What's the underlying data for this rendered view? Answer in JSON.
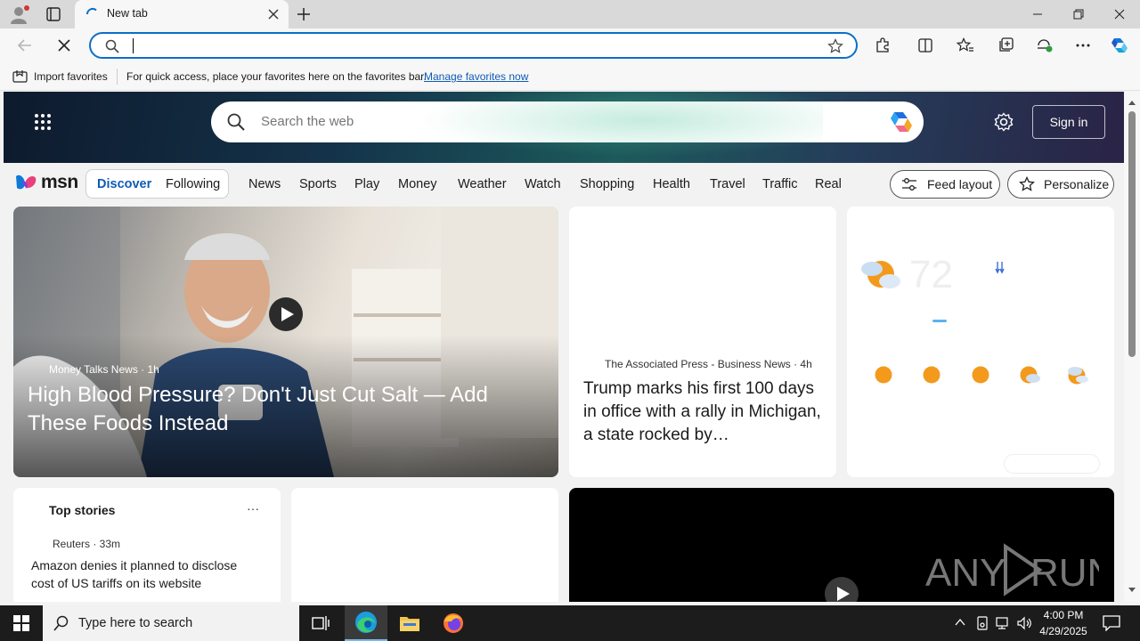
{
  "browser": {
    "tab_title": "New tab",
    "address_value": "",
    "colors": {
      "accent": "#0b6fc9",
      "link": "#0f5bb5"
    }
  },
  "favorites_bar": {
    "import_label": "Import favorites",
    "hint": "For quick access, place your favorites here on the favorites bar.",
    "manage_link": "Manage favorites now"
  },
  "msn": {
    "search_placeholder": "Search the web",
    "signin_label": "Sign in",
    "logo_word": "msn",
    "tabs": [
      {
        "label": "Discover",
        "selected": true
      },
      {
        "label": "Following",
        "selected": false
      }
    ],
    "nav": [
      "News",
      "Sports",
      "Play",
      "Money",
      "Weather",
      "Watch",
      "Shopping",
      "Health",
      "Travel",
      "Traffic",
      "Real E"
    ],
    "feed_layout_label": "Feed layout",
    "personalize_label": "Personalize",
    "hero": {
      "source": "Money Talks News · 1h",
      "title": "High Blood Pressure? Don't Just Cut Salt — Add These Foods Instead"
    },
    "story2": {
      "source": "The Associated Press - Business News · 4h",
      "title": "Trump marks his first 100 days in office with a rally in Michigan, a state rocked by…"
    },
    "weather": {
      "temp": "72",
      "forecast_icons": [
        "sun-icon",
        "sun-icon",
        "sun-icon",
        "partly-cloudy-icon",
        "partly-cloudy-icon"
      ]
    },
    "top_stories": {
      "heading": "Top stories",
      "more": "···",
      "items": [
        {
          "source": "Reuters · 33m",
          "title": "Amazon denies it planned to disclose cost of US tariffs on its website"
        }
      ]
    },
    "video_watermark": "ANY RUN"
  },
  "taskbar": {
    "search_placeholder": "Type here to search",
    "time": "4:00 PM",
    "date": "4/29/2025"
  }
}
